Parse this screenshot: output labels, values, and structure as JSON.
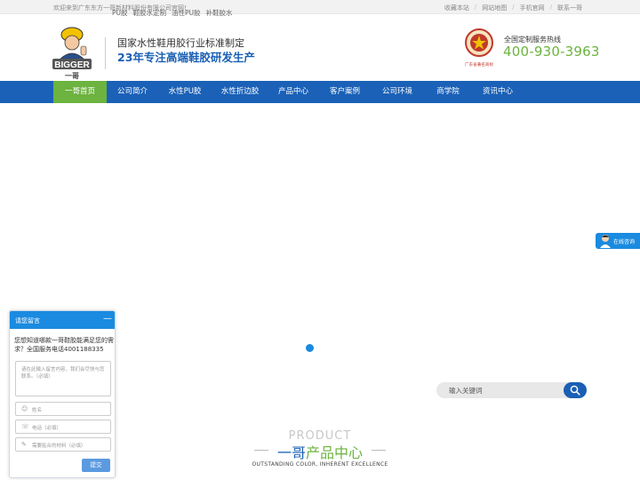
{
  "topbar": {
    "welcome": "欢迎来到广东东方一哥新材料股份有限公司官网!",
    "links": [
      "收藏本站",
      "网站地图",
      "手机官网",
      "联系一哥"
    ]
  },
  "header": {
    "logo_text": "BIGGER",
    "logo_sub": "一哥",
    "slogan_line1": "国家水性鞋用胶行业标准制定",
    "slogan_line2": "23年专注高端鞋胶研发生产",
    "badge_caption": "广东省著名商标",
    "hotline_label": "全国定制服务热线",
    "hotline_number": "400-930-3963"
  },
  "nav": {
    "items": [
      {
        "label": "一哥首页",
        "active": true
      },
      {
        "label": "公司简介",
        "active": false
      },
      {
        "label": "水性PU胶",
        "active": false
      },
      {
        "label": "水性折边胶",
        "active": false
      },
      {
        "label": "产品中心",
        "active": false
      },
      {
        "label": "客户案例",
        "active": false
      },
      {
        "label": "公司环境",
        "active": false
      },
      {
        "label": "商学院",
        "active": false
      },
      {
        "label": "资讯中心",
        "active": false
      }
    ]
  },
  "hot_keywords": [
    "PU胶",
    "鞋胶水定制",
    "油性PU胶",
    "补鞋胶水"
  ],
  "search": {
    "placeholder": "输入关键词"
  },
  "product_section": {
    "title_en": "PRODUCT",
    "title_cn_part1": "一哥",
    "title_cn_part2": "产品中心",
    "subtitle": "OUTSTANDING COLOR, INHERENT EXCELLENCE"
  },
  "online_tab": {
    "label": "在线咨询"
  },
  "chat": {
    "title": "请您留言",
    "minimize": "—",
    "intro": "您想知道哪款一哥鞋胶能满足您的需求？全国服务电话4001188335",
    "message_placeholder": "请在此输入留言内容，我们会尽快与您联系。（必填）",
    "name_placeholder": "姓名",
    "phone_placeholder": "电话（必填）",
    "material_placeholder": "需要贴合的材料（必填）",
    "submit_label": "提交"
  },
  "colors": {
    "brand_blue": "#1a61b7",
    "accent_green": "#6cb33f",
    "chat_blue": "#1a8be0"
  }
}
